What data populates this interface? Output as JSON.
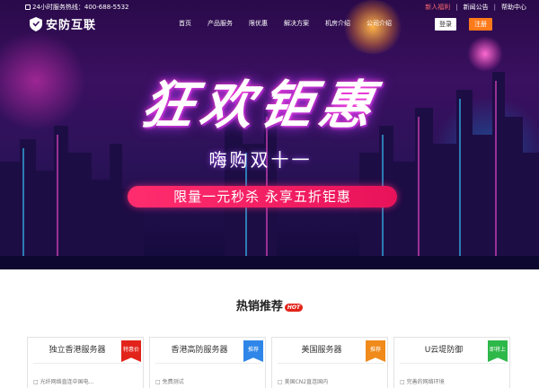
{
  "topbar": {
    "hotline": "24小时服务热线：400-688-5532",
    "links": [
      "新人福利",
      "新闻公告",
      "帮助中心"
    ]
  },
  "navbar": {
    "logo_text": "安防互联",
    "items": [
      "首页",
      "产品服务",
      "限优惠",
      "解决方案",
      "机房介绍",
      "公司介绍"
    ],
    "login_label": "登录",
    "register_label": "注册"
  },
  "hero": {
    "headline": "狂欢钜惠",
    "subhead": "嗨购双十一",
    "promo": "限量一元秒杀 永享五折钜惠"
  },
  "section": {
    "title": "热销推荐",
    "hot_badge": "HOT"
  },
  "cards": [
    {
      "title": "独立香港服务器",
      "ribbon": "特惠价",
      "ribbon_color": "#e2231a",
      "feature": "□ 光纤网络直连中国电..."
    },
    {
      "title": "香港高防服务器",
      "ribbon": "推荐",
      "ribbon_color": "#2f86e8",
      "feature": "□ 免费测试"
    },
    {
      "title": "美国服务器",
      "ribbon": "推荐",
      "ribbon_color": "#f08a1a",
      "feature": "□ 美国CN2直连国内"
    },
    {
      "title": "U云堤防御",
      "ribbon": "即将上",
      "ribbon_color": "#2eb84a",
      "feature": "□ 完善的网络环境"
    }
  ],
  "colors": {
    "accent_orange": "#ff7a1a",
    "promo_pink": "#ff2d6e",
    "hero_purple": "#3a1060"
  }
}
